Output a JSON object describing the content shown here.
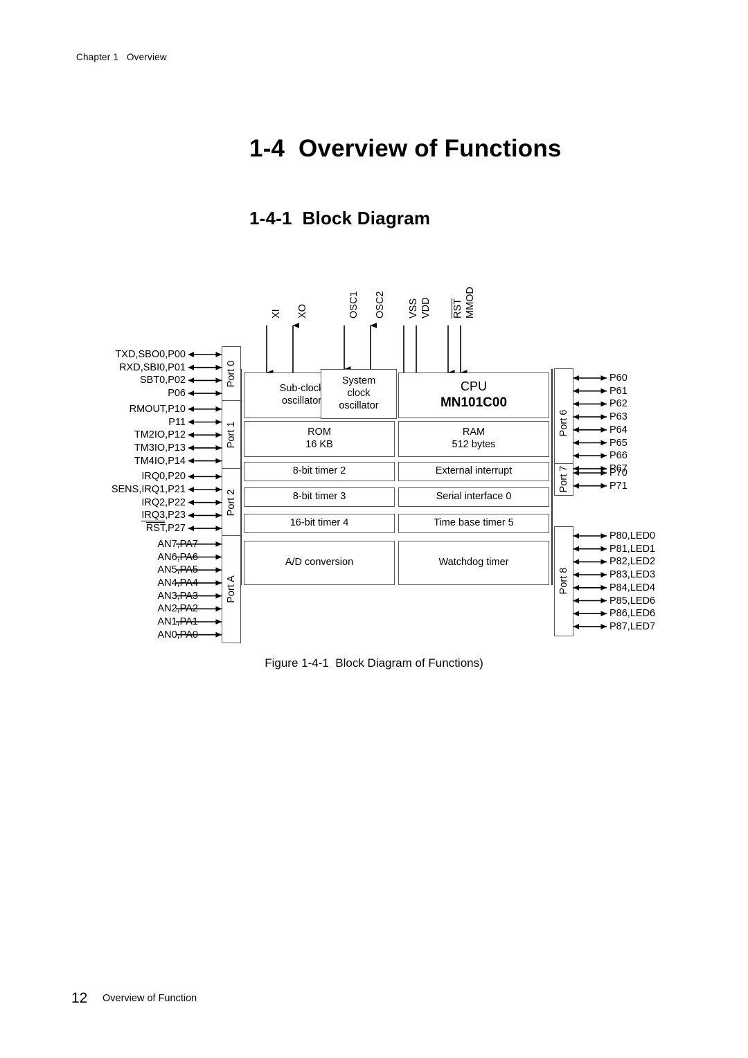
{
  "page": {
    "chapter_header": "Chapter 1   Overview",
    "title": "1-4  Overview of Functions",
    "section_title": "1-4-1  Block Diagram",
    "figure_caption": "Figure 1-4-1  Block Diagram of Functions)",
    "footer_page_number": "12",
    "footer_text": "Overview of Function"
  },
  "diagram": {
    "top_signals": [
      {
        "label": "XI",
        "direction": "in",
        "overline": false
      },
      {
        "label": "XO",
        "direction": "out",
        "overline": false
      },
      {
        "label": "OSC1",
        "direction": "in",
        "overline": false
      },
      {
        "label": "OSC2",
        "direction": "out",
        "overline": false
      },
      {
        "label": "VSS",
        "direction": "none",
        "overline": false
      },
      {
        "label": "VDD",
        "direction": "none",
        "overline": false
      },
      {
        "label": "RST",
        "direction": "in",
        "overline": true
      },
      {
        "label": "MMOD",
        "direction": "in",
        "overline": false
      }
    ],
    "left_ports": [
      {
        "name": "Port 0",
        "pins": [
          {
            "label": "TXD,SBO0,P00",
            "bidirectional": true
          },
          {
            "label": "RXD,SBI0,P01",
            "bidirectional": true
          },
          {
            "label": "SBT0,P02",
            "bidirectional": true
          },
          {
            "label": "P06",
            "bidirectional": true
          }
        ]
      },
      {
        "name": "Port 1",
        "pins": [
          {
            "label": "RMOUT,P10",
            "bidirectional": true
          },
          {
            "label": "P11",
            "bidirectional": true
          },
          {
            "label": "TM2IO,P12",
            "bidirectional": true
          },
          {
            "label": "TM3IO,P13",
            "bidirectional": true
          },
          {
            "label": "TM4IO,P14",
            "bidirectional": true
          }
        ]
      },
      {
        "name": "Port 2",
        "pins": [
          {
            "label": "IRQ0,P20",
            "bidirectional": true
          },
          {
            "label": "SENS,IRQ1,P21",
            "bidirectional": true
          },
          {
            "label": "IRQ2,P22",
            "bidirectional": true
          },
          {
            "label": "IRQ3,P23",
            "bidirectional": true,
            "underline_prefix": "IRQ3"
          },
          {
            "label": "RST,P27",
            "bidirectional": true,
            "overline_prefix": "RST"
          }
        ]
      },
      {
        "name": "Port A",
        "pins": [
          {
            "label": "AN7,PA7",
            "bidirectional": false
          },
          {
            "label": "AN6,PA6",
            "bidirectional": false
          },
          {
            "label": "AN5,PA5",
            "bidirectional": false
          },
          {
            "label": "AN4,PA4",
            "bidirectional": false
          },
          {
            "label": "AN3,PA3",
            "bidirectional": false
          },
          {
            "label": "AN2,PA2",
            "bidirectional": false
          },
          {
            "label": "AN1,PA1",
            "bidirectional": false
          },
          {
            "label": "AN0,PA0",
            "bidirectional": false
          }
        ]
      }
    ],
    "right_ports": [
      {
        "name": "Port 6",
        "pins": [
          {
            "label": "P60",
            "bidirectional": true
          },
          {
            "label": "P61",
            "bidirectional": true
          },
          {
            "label": "P62",
            "bidirectional": true
          },
          {
            "label": "P63",
            "bidirectional": true
          },
          {
            "label": "P64",
            "bidirectional": true
          },
          {
            "label": "P65",
            "bidirectional": true
          },
          {
            "label": "P66",
            "bidirectional": true
          },
          {
            "label": "P67",
            "bidirectional": true
          }
        ]
      },
      {
        "name": "Port 7",
        "pins": [
          {
            "label": "P70",
            "bidirectional": true
          },
          {
            "label": "P71",
            "bidirectional": true
          }
        ]
      },
      {
        "name": "Port 8",
        "pins": [
          {
            "label": "P80,LED0",
            "bidirectional": true
          },
          {
            "label": "P81,LED1",
            "bidirectional": true
          },
          {
            "label": "P82,LED2",
            "bidirectional": true
          },
          {
            "label": "P83,LED3",
            "bidirectional": true
          },
          {
            "label": "P84,LED4",
            "bidirectional": true
          },
          {
            "label": "P85,LED6",
            "bidirectional": true
          },
          {
            "label": "P86,LED6",
            "bidirectional": true
          },
          {
            "label": "P87,LED7",
            "bidirectional": true
          }
        ]
      }
    ],
    "blocks": {
      "sub_clock_oscillator": "Sub-clock\noscillator",
      "system_clock_oscillator": "System\nclock\noscillator",
      "cpu_title": "CPU",
      "cpu_name": "MN101C00",
      "rom_title": "ROM",
      "rom_size": "16 KB",
      "ram_title": "RAM",
      "ram_size": "512 bytes",
      "timer2": "8-bit timer 2",
      "timer3": "8-bit timer 3",
      "timer4": "16-bit timer 4",
      "ad_conversion": "A/D conversion",
      "external_interrupt": "External interrupt",
      "serial_interface": "Serial interface 0",
      "time_base_timer": "Time base timer 5",
      "watchdog_timer": "Watchdog timer"
    },
    "colors": {
      "line": "#555555",
      "arrow": "#000000",
      "text": "#000000",
      "background": "#ffffff"
    }
  }
}
